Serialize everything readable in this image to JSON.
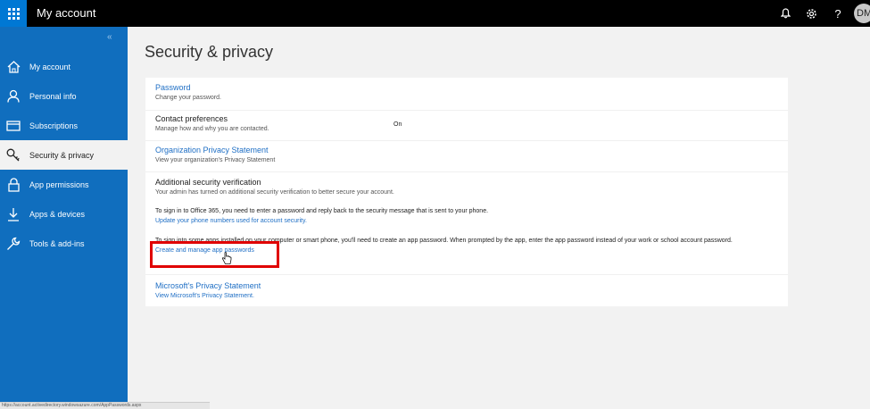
{
  "topbar": {
    "app_title": "My account",
    "avatar_initials": "DM",
    "icons": [
      "waffle-icon",
      "bell-icon",
      "gear-icon",
      "help-icon"
    ],
    "help_label": "?"
  },
  "sidebar": {
    "collapse_glyph": "«",
    "items": [
      {
        "label": "My account",
        "icon": "home-icon"
      },
      {
        "label": "Personal info",
        "icon": "person-icon"
      },
      {
        "label": "Subscriptions",
        "icon": "card-icon"
      },
      {
        "label": "Security & privacy",
        "icon": "key-icon",
        "active": true
      },
      {
        "label": "App permissions",
        "icon": "lock-icon"
      },
      {
        "label": "Apps & devices",
        "icon": "download-icon"
      },
      {
        "label": "Tools & add-ins",
        "icon": "wrench-icon"
      }
    ]
  },
  "main": {
    "title": "Security & privacy",
    "password": {
      "title": "Password",
      "desc": "Change your password."
    },
    "contact": {
      "title": "Contact preferences",
      "desc": "Manage how and why you are contacted.",
      "status": "On"
    },
    "org_privacy": {
      "title": "Organization Privacy Statement",
      "desc": "View your organization's Privacy Statement"
    },
    "security_verification": {
      "title": "Additional security verification",
      "desc": "Your admin has turned on additional security verification to better secure your account.",
      "signin_text": "To sign in to Office 365, you need to enter a password and reply back to the security message that is sent to your phone.",
      "update_link": "Update your phone numbers used for account security.",
      "app_password_text": "To sign into some apps installed on your computer or smart phone, you'll need to create an app password. When prompted by the app, enter the app password instead of your work or school account password.",
      "app_password_link": "Create and manage app passwords"
    },
    "ms_privacy": {
      "title": "Microsoft's Privacy Statement",
      "desc": "View Microsoft's Privacy Statement."
    }
  },
  "statusbar": {
    "url": "https://account.activedirectory.windowsazure.com/AppPasswords.aspx"
  },
  "colors": {
    "accent": "#106ebe",
    "link": "#1f6fc5",
    "highlight": "#e00000"
  }
}
